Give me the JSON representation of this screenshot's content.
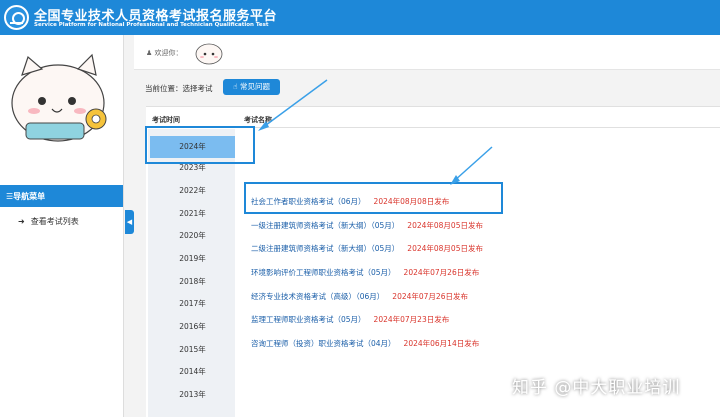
{
  "header": {
    "title_cn": "全国专业技术人员资格考试报名服务平台",
    "title_en": "Service Platform for National Professional and Technician Qualification Test"
  },
  "topbar": {
    "welcome": "欢迎你："
  },
  "sidebar": {
    "nav_title": "☰导航菜单",
    "items": [
      {
        "label": "查看考试列表"
      }
    ]
  },
  "breadcrumb": {
    "label": "当前位置：选择考试"
  },
  "faq_button": {
    "label": "常见问题"
  },
  "table": {
    "col_time": "考试时间",
    "col_name": "考试名称",
    "years": [
      "2024年",
      "2023年",
      "2022年",
      "2021年",
      "2020年",
      "2019年",
      "2018年",
      "2017年",
      "2016年",
      "2015年",
      "2014年",
      "2013年"
    ],
    "exams": [
      {
        "name": "社会工作者职业资格考试（06月）",
        "date": "2024年08月08日发布"
      },
      {
        "name": "一级注册建筑师资格考试（新大纲）（05月）",
        "date": "2024年08月05日发布"
      },
      {
        "name": "二级注册建筑师资格考试（新大纲）（05月）",
        "date": "2024年08月05日发布"
      },
      {
        "name": "环境影响评价工程师职业资格考试（05月）",
        "date": "2024年07月26日发布"
      },
      {
        "name": "经济专业技术资格考试（高级）（06月）",
        "date": "2024年07月26日发布"
      },
      {
        "name": "监理工程师职业资格考试（05月）",
        "date": "2024年07月23日发布"
      },
      {
        "name": "咨询工程师（投资）职业资格考试（04月）",
        "date": "2024年06月14日发布"
      }
    ]
  },
  "watermark": "知乎 @中大职业培训",
  "colors": {
    "brand": "#1e88d8",
    "date": "#d9342b",
    "link": "#1a5ea8"
  }
}
